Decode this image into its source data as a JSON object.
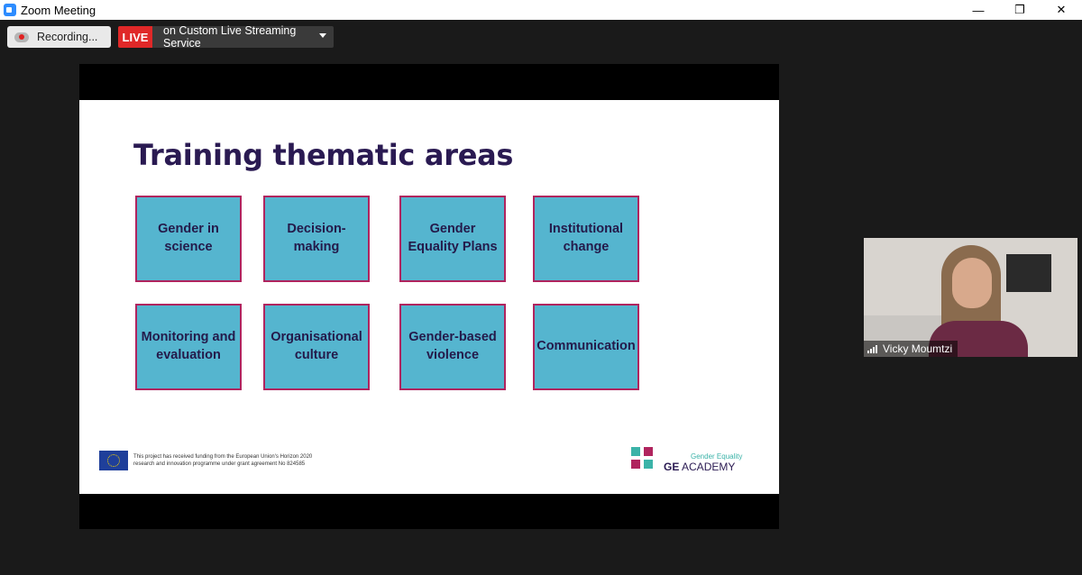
{
  "window": {
    "title": "Zoom Meeting",
    "controls": [
      "minimize-icon",
      "restore-icon",
      "close-icon"
    ]
  },
  "toolbar": {
    "recording_label": "Recording...",
    "live_label": "LIVE",
    "stream_label": "on Custom Live Streaming Service"
  },
  "slide": {
    "title": "Training thematic areas",
    "tiles": [
      "Gender in science",
      "Decision-making",
      "Gender Equality Plans",
      "Institutional change",
      "Monitoring and evaluation",
      "Organisational culture",
      "Gender-based violence",
      "Communication"
    ],
    "funding_text": "This project has received funding from the European Union's Horizon 2020 research and innovation programme under grant agreement No 824585",
    "logo": {
      "tagline": "Gender Equality",
      "name_bold": "GE",
      "name_rest": " ACADEMY"
    }
  },
  "participant": {
    "name": "Vicky Moumtzi"
  },
  "colors": {
    "tile_fill": "#55b5cf",
    "tile_border": "#b0245e",
    "title_text": "#2a1a52",
    "live_red": "#e02828"
  }
}
